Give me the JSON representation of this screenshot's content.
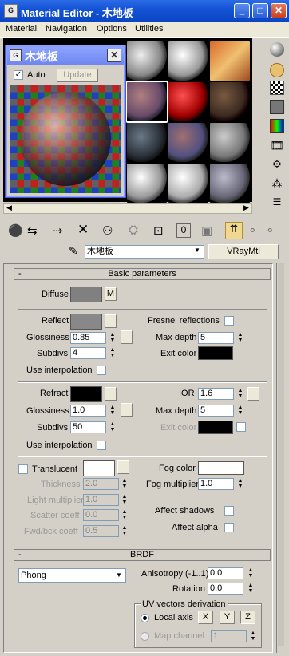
{
  "window": {
    "title": "Material Editor - 木地板"
  },
  "menu": [
    "Material",
    "Navigation",
    "Options",
    "Utilities"
  ],
  "popup": {
    "title": "木地板",
    "auto_label": "Auto",
    "update_label": "Update"
  },
  "material": {
    "name": "木地板",
    "type": "VRayMtl"
  },
  "basic": {
    "header": "Basic parameters",
    "diffuse": "Diffuse",
    "diffuse_map": "M",
    "reflect": "Reflect",
    "fresnel": "Fresnel reflections",
    "glossiness": "Glossiness",
    "refl_gloss": "0.85",
    "max_depth": "Max depth",
    "refl_depth": "5",
    "subdivs": "Subdivs",
    "refl_subdivs": "4",
    "exit_color": "Exit color",
    "use_interp": "Use interpolation",
    "refract": "Refract",
    "ior": "IOR",
    "ior_val": "1.6",
    "refr_gloss": "1.0",
    "refr_depth": "5",
    "refr_subdivs": "50",
    "translucent": "Translucent",
    "fog_color": "Fog color",
    "thickness": "Thickness",
    "thickness_val": "2.0",
    "fog_mult": "Fog multiplier",
    "fog_mult_val": "1.0",
    "light_mult": "Light multiplier",
    "light_mult_val": "1.0",
    "scatter": "Scatter coeff",
    "scatter_val": "0.0",
    "fwd": "Fwd/bck coeff",
    "fwd_val": "0.5",
    "affect_shadows": "Affect shadows",
    "affect_alpha": "Affect alpha"
  },
  "brdf": {
    "header": "BRDF",
    "type": "Phong",
    "aniso": "Anisotropy (-1..1)",
    "aniso_val": "0.0",
    "rotation": "Rotation",
    "rotation_val": "0.0",
    "uv_group": "UV vectors derivation",
    "local_axis": "Local axis",
    "x": "X",
    "y": "Y",
    "z": "Z",
    "map_channel": "Map channel",
    "map_channel_val": "1"
  },
  "rollout_minus": "-",
  "colors": {
    "diffuse": "#808080",
    "reflect": "#888888",
    "exit": "#000000",
    "refract": "#000000",
    "refr_exit": "#000000",
    "translucent": "#ffffff",
    "fog": "#ffffff",
    "title": "#0a46c4"
  },
  "icons": [
    "sample-type-icon",
    "backlight-icon",
    "background-icon",
    "sample-uv-tiling-icon",
    "video-color-check-icon",
    "make-preview-icon",
    "options-icon",
    "select-by-material-icon",
    "material-navigator-icon",
    "get-material-icon",
    "put-to-scene-icon",
    "assign-to-selection-icon",
    "reset-map-icon",
    "make-unique-icon",
    "put-to-library-icon",
    "material-effects-channel-icon",
    "show-map-icon",
    "show-end-result-icon",
    "go-to-parent-icon",
    "go-forward-sibling-icon",
    "pick-material-icon"
  ]
}
